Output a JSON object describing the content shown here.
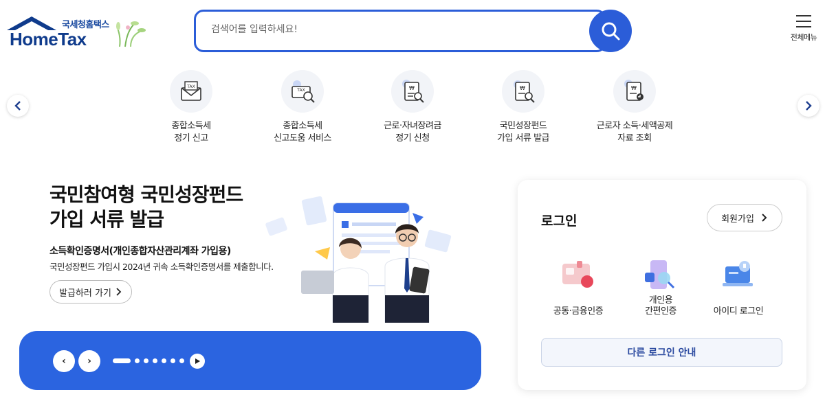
{
  "header": {
    "logo_kr": "국세청홈택스",
    "logo_en": "HomeTax",
    "search_placeholder": "검색어를 입력하세요!",
    "menu_label": "전체메뉴"
  },
  "quick_menu": [
    {
      "line1": "종합소득세",
      "line2": "정기 신고",
      "icon": "tax-envelope-icon"
    },
    {
      "line1": "종합소득세",
      "line2": "신고도움 서비스",
      "icon": "tax-search-icon"
    },
    {
      "line1": "근로·자녀장려금",
      "line2": "정기 신청",
      "icon": "won-document-search-icon"
    },
    {
      "line1": "국민성장펀드",
      "line2": "가입 서류 발급",
      "icon": "won-document-issue-icon"
    },
    {
      "line1": "근로자 소득·세액공제",
      "line2": "자료 조회",
      "icon": "receipt-lookup-icon"
    }
  ],
  "banner": {
    "title_line1": "국민참여형 국민성장펀드",
    "title_line2": "가입 서류 발급",
    "subtitle": "소득확인증명서(개인종합자산관리계좌 가입용)",
    "description": "국민성장펀드 가입시 2024년 귀속 소득확인증명서를 제출합니다.",
    "cta": "발급하러 가기",
    "prev_label": "‹",
    "next_label": "›",
    "dot_count": 7,
    "active_dot": 0
  },
  "login": {
    "title": "로그인",
    "signup": "회원가입",
    "options": [
      {
        "label": "공동·금융인증",
        "icon": "certificate-card-icon"
      },
      {
        "label": "개인용\n간편인증",
        "icon": "mobile-simple-auth-icon"
      },
      {
        "label": "아이디 로그인",
        "icon": "laptop-id-login-icon"
      }
    ],
    "other": "다른 로그인 안내"
  },
  "colors": {
    "primary": "#2b5dd8",
    "banner_bar": "#2b64e0",
    "text_dark": "#111111"
  }
}
